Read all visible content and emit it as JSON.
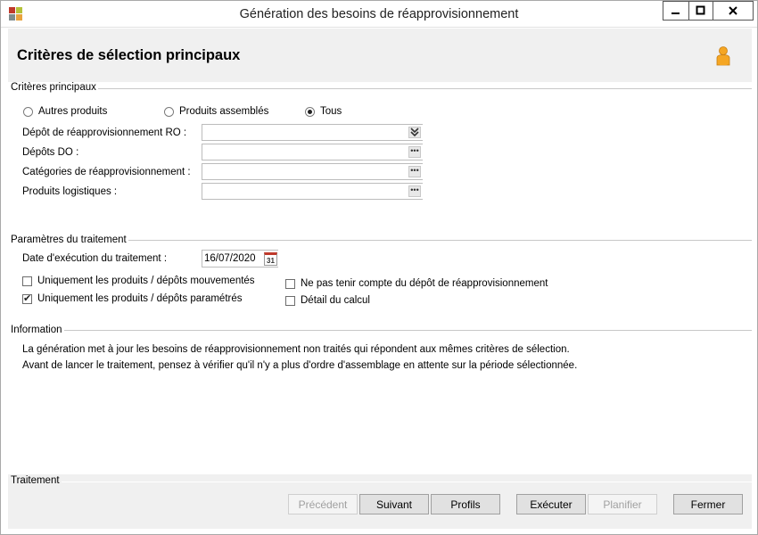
{
  "window": {
    "title": "Génération des besoins de réapprovisionnement"
  },
  "header": {
    "title": "Critères de sélection principaux"
  },
  "criteria": {
    "group_label": "Critères principaux",
    "radios": [
      {
        "label": "Autres produits",
        "checked": false
      },
      {
        "label": "Produits assemblés",
        "checked": false
      },
      {
        "label": "Tous",
        "checked": true
      }
    ],
    "fields": [
      {
        "label": "Dépôt de réapprovisionnement  RO :",
        "value": "",
        "button": "chevron"
      },
      {
        "label": "Dépôts DO :",
        "value": "",
        "button": "ellipsis"
      },
      {
        "label": "Catégories de réapprovisionnement :",
        "value": "",
        "button": "ellipsis"
      },
      {
        "label": "Produits logistiques :",
        "value": "",
        "button": "ellipsis"
      }
    ]
  },
  "params": {
    "group_label": "Paramètres du traitement",
    "date_label": "Date d'exécution du traitement :",
    "date_value": "16/07/2020",
    "calendar_day": "31",
    "checkboxes": [
      {
        "label": "Uniquement les produits / dépôts mouvementés",
        "checked": false
      },
      {
        "label": "Uniquement les produits / dépôts paramétrés",
        "checked": true
      },
      {
        "label": "Ne pas tenir compte du dépôt de réapprovisionnement",
        "checked": false
      },
      {
        "label": "Détail du calcul",
        "checked": false
      }
    ]
  },
  "information": {
    "group_label": "Information",
    "lines": [
      "La génération met à jour les besoins de réapprovisionnement non traités qui répondent aux mêmes critères de sélection.",
      "Avant de lancer le traitement, pensez à vérifier qu'il n'y a plus d'ordre d'assemblage en attente sur la période sélectionnée."
    ]
  },
  "treatment": {
    "group_label": "Traitement",
    "buttons": [
      {
        "label": "Précédent",
        "enabled": false
      },
      {
        "label": "Suivant",
        "enabled": true
      },
      {
        "label": "Profils",
        "enabled": true
      },
      {
        "label": "Exécuter",
        "enabled": true
      },
      {
        "label": "Planifier",
        "enabled": false
      },
      {
        "label": "Fermer",
        "enabled": true
      }
    ]
  },
  "colors": {
    "header_bg": "#f0f0f0",
    "user_icon": "#f5a623"
  }
}
